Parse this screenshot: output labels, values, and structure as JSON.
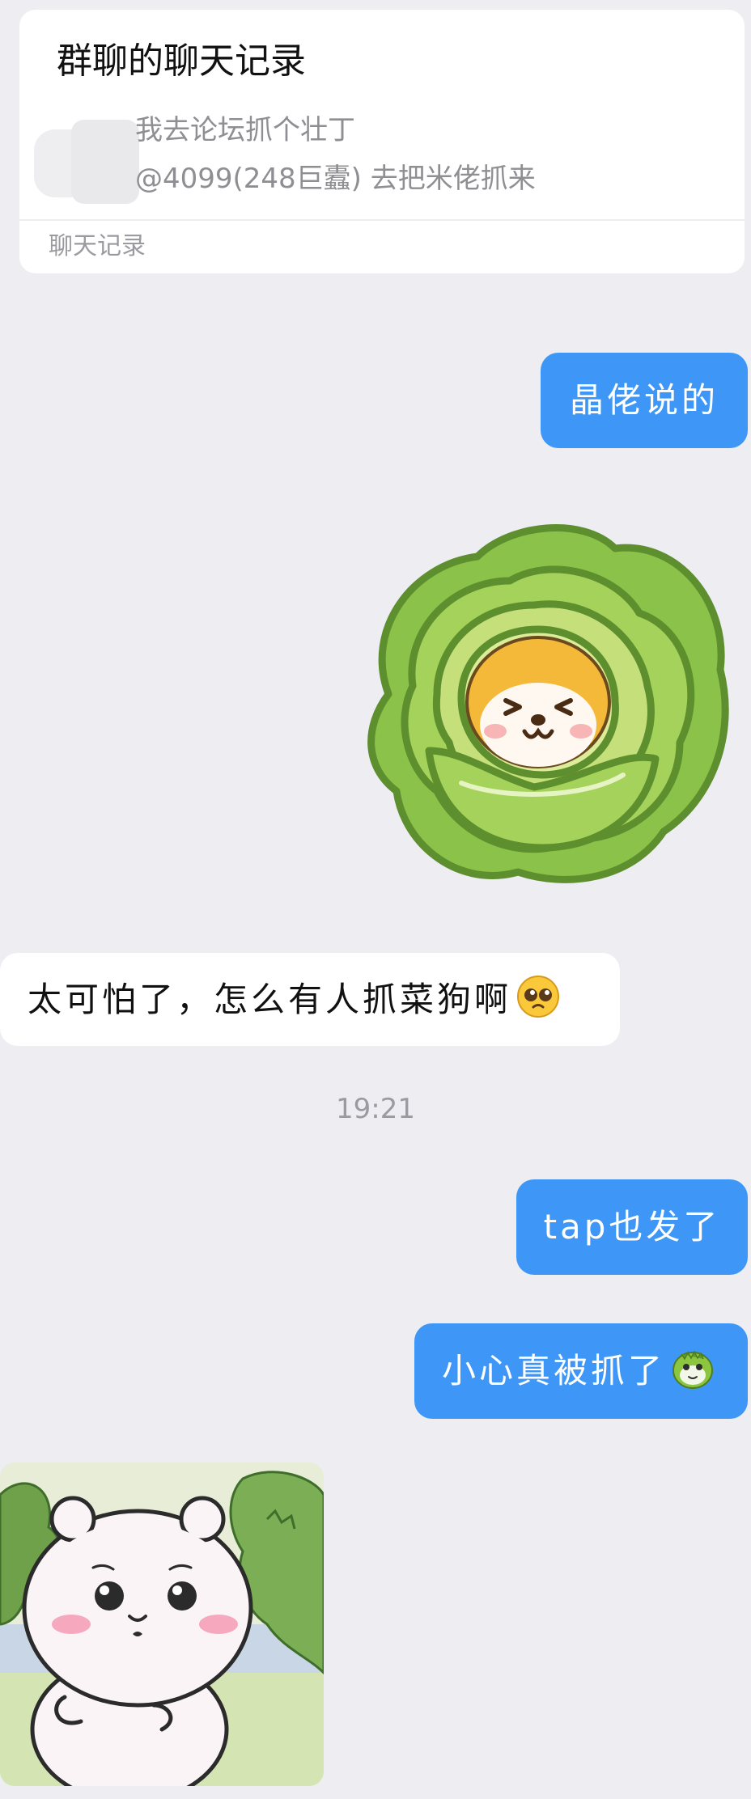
{
  "record_card": {
    "title": "群聊的聊天记录",
    "line1": "我去论坛抓个壮丁",
    "line2": "@4099(248巨蠹) 去把米佬抓来",
    "footer": "聊天记录"
  },
  "messages": {
    "m1": "晶佬说的",
    "m2": "太可怕了，怎么有人抓菜狗啊",
    "timestamp": "19:21",
    "m3": "tap也发了",
    "m4": "小心真被抓了"
  },
  "stickers": {
    "cabbage": "cabbage-dog-sticker",
    "bear": "white-bear-sticker"
  },
  "colors": {
    "background": "#EDEDF2",
    "my_bubble": "#3E97F6",
    "other_bubble": "#FFFFFF"
  }
}
